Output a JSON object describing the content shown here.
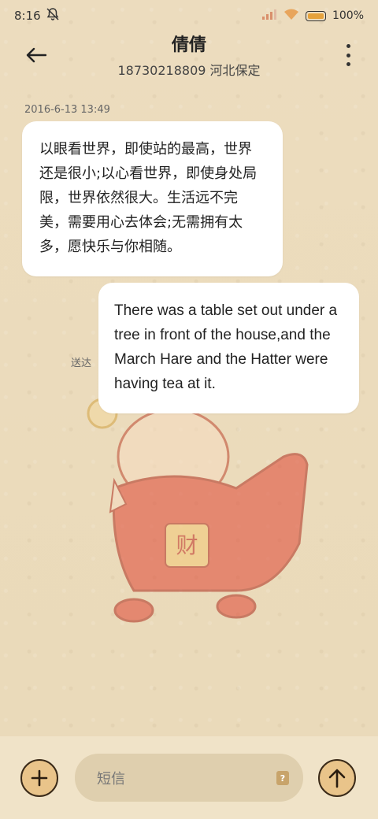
{
  "status_bar": {
    "time": "8:16",
    "battery": "100%"
  },
  "header": {
    "contact_name": "倩倩",
    "contact_detail": "18730218809 河北保定"
  },
  "conversation": {
    "timestamp": "2016-6-13 13:49",
    "incoming_message": "以眼看世界，即使站的最高，世界还是很小;以心看世界，即使身处局限，世界依然很大。生活远不完美，需要用心去体会;无需拥有太多，愿快乐与你相随。",
    "outgoing_message": "There was a table set out under a tree in front of the house,and the March Hare and the Hatter were having tea at it.",
    "delivery_status": "送达"
  },
  "illustration": {
    "badge_char": "财"
  },
  "composer": {
    "placeholder": "短信"
  }
}
